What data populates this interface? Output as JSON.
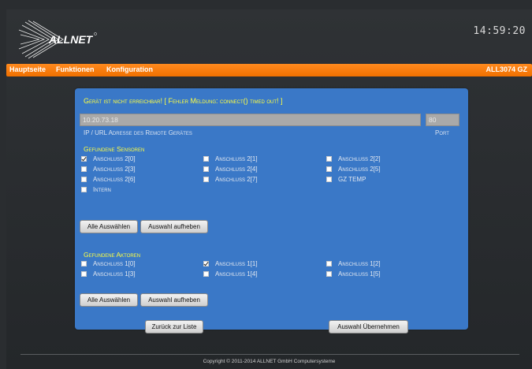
{
  "header": {
    "logo_text": "ALLNET",
    "clock": "14:59:20"
  },
  "nav": {
    "items": [
      "Hauptseite",
      "Funktionen",
      "Konfiguration"
    ],
    "device": "ALL3074 GZ"
  },
  "remote": {
    "error_message": "Gerät ist nicht erreichbar! [ Fehler Meldung: connect() timed out! ]",
    "ip_value": "10.20.73.18",
    "ip_label": "IP / URL Adresse des Remote Gerätes",
    "port_value": "80",
    "port_label": "Port"
  },
  "sensors": {
    "title": "Gefundene Sensoren",
    "items": [
      {
        "label": "Anschluß 2[0]",
        "checked": true
      },
      {
        "label": "Anschluß 2[1]",
        "checked": false
      },
      {
        "label": "Anschluß 2[2]",
        "checked": false
      },
      {
        "label": "Anschluß 2[3]",
        "checked": false
      },
      {
        "label": "Anschluß 2[4]",
        "checked": false
      },
      {
        "label": "Anschluß 2[5]",
        "checked": false
      },
      {
        "label": "Anschluß 2[6]",
        "checked": false
      },
      {
        "label": "Anschluß 2[7]",
        "checked": false
      },
      {
        "label": "GZ TEMP",
        "checked": false
      },
      {
        "label": "Intern",
        "checked": false
      }
    ],
    "select_all": "Alle Auswählen",
    "deselect": "Auswahl aufheben"
  },
  "actors": {
    "title": "Gefundene Aktoren",
    "items": [
      {
        "label": "Anschluß 1[0]",
        "checked": false
      },
      {
        "label": "Anschluß 1[1]",
        "checked": true
      },
      {
        "label": "Anschluß 1[2]",
        "checked": false
      },
      {
        "label": "Anschluß 1[3]",
        "checked": false
      },
      {
        "label": "Anschluß 1[4]",
        "checked": false
      },
      {
        "label": "Anschluß 1[5]",
        "checked": false
      }
    ],
    "select_all": "Alle Auswählen",
    "deselect": "Auswahl aufheben"
  },
  "actions": {
    "back": "Zurück zur Liste",
    "apply": "Auswahl Übernehmen"
  },
  "footer": {
    "copyright": "Copyright © 2011-2014 ALLNET GmbH Computersysteme"
  },
  "colors": {
    "nav_orange": "#f07000",
    "panel_blue": "#3a78c7",
    "highlight_yellow": "#ffff40"
  }
}
